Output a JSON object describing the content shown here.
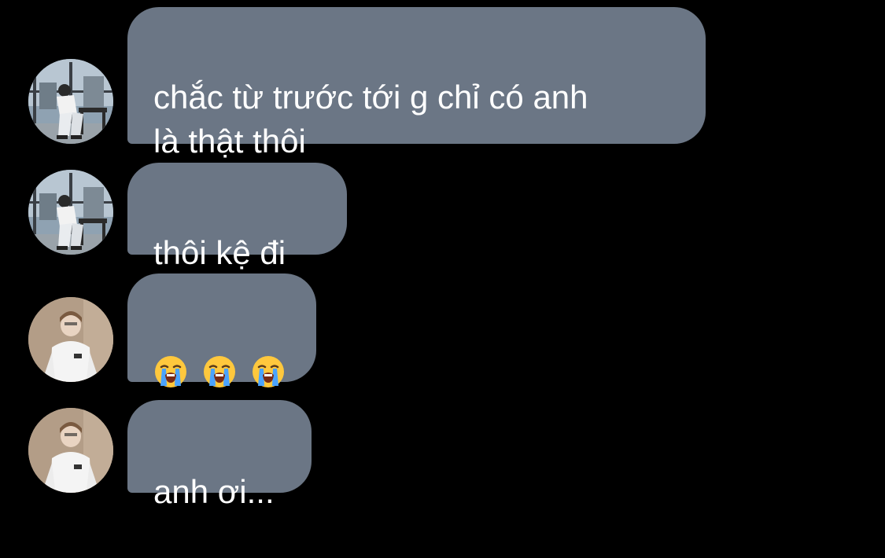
{
  "messages": [
    {
      "sender_avatar": "avatar-window-photo",
      "text": "chắc từ trước tới g chỉ có anh\nlà thật thôi"
    },
    {
      "sender_avatar": "avatar-window-photo",
      "text": "thôi kệ đi"
    },
    {
      "sender_avatar": "avatar-white-outfit-photo",
      "emojis": [
        "loudly-crying-face-icon",
        "loudly-crying-face-icon",
        "loudly-crying-face-icon"
      ]
    },
    {
      "sender_avatar": "avatar-white-outfit-photo",
      "text": "anh ơi..."
    }
  ],
  "colors": {
    "background": "#000000",
    "bubble": "#6b7685",
    "text": "#ffffff"
  }
}
